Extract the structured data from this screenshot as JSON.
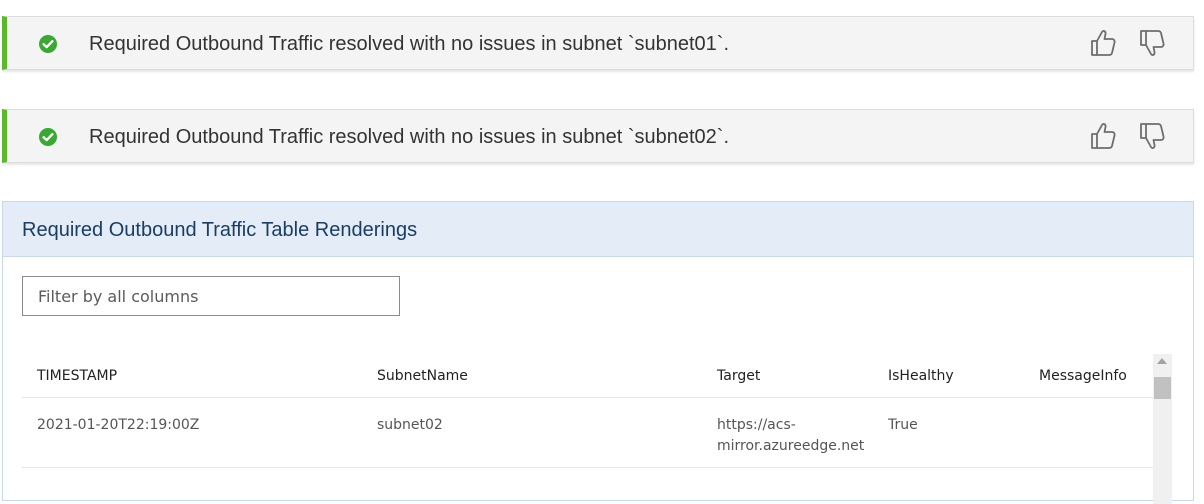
{
  "insights": [
    {
      "status": "success",
      "message": "Required Outbound Traffic resolved with no issues in subnet `subnet01`.",
      "thumbs_up_icon": "thumbs-up-icon",
      "thumbs_down_icon": "thumbs-down-icon"
    },
    {
      "status": "success",
      "message": "Required Outbound Traffic resolved with no issues in subnet `subnet02`.",
      "thumbs_up_icon": "thumbs-up-icon",
      "thumbs_down_icon": "thumbs-down-icon"
    }
  ],
  "panel": {
    "title": "Required Outbound Traffic Table Renderings",
    "filter_placeholder": "Filter by all columns",
    "filter_value": ""
  },
  "table": {
    "columns": [
      "TIMESTAMP",
      "SubnetName",
      "Target",
      "IsHealthy",
      "MessageInfo"
    ],
    "rows": [
      [
        "2021-01-20T22:19:00Z",
        "subnet02",
        "https://acs-mirror.azureedge.net",
        "True",
        ""
      ]
    ]
  },
  "colors": {
    "success_accent": "#5cb82c",
    "panel_header_bg": "#e3ecf7",
    "panel_title": "#1c3d63"
  }
}
